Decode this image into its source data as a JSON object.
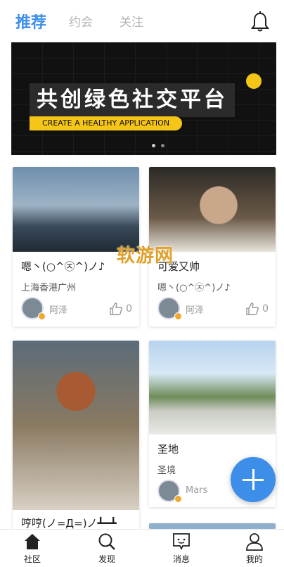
{
  "header": {
    "tabs": [
      {
        "label": "推荐",
        "active": true
      },
      {
        "label": "约会",
        "active": false
      },
      {
        "label": "关注",
        "active": false
      }
    ],
    "bell_icon": "bell-icon"
  },
  "banner": {
    "title": "共创绿色社交平台",
    "subtitle": "CREATE A HEALTHY APPLICATION",
    "accent": "#f5c518"
  },
  "cards": [
    {
      "title": "嗯丶(○^㉨^)ノ♪",
      "subtitle": "上海香港广州",
      "author": "阿泽",
      "likes": "0"
    },
    {
      "title": "可爱又帅",
      "subtitle": "嗯丶(○^㉨^)ノ♪",
      "author": "阿泽",
      "likes": "0"
    },
    {
      "title": "哼哼(ノ=Д=)ノ┻━┻",
      "subtitle": "",
      "author": "",
      "likes": ""
    },
    {
      "title": "圣地",
      "subtitle": "圣境",
      "author": "Mars",
      "likes": ""
    }
  ],
  "watermark": "软游网",
  "nav": {
    "items": [
      {
        "label": "社区",
        "icon": "home-icon"
      },
      {
        "label": "发现",
        "icon": "search-icon"
      },
      {
        "label": "消息",
        "icon": "message-icon"
      },
      {
        "label": "我的",
        "icon": "user-icon"
      }
    ]
  },
  "colors": {
    "accent": "#3d8ee8",
    "muted": "#b5b5b5"
  }
}
